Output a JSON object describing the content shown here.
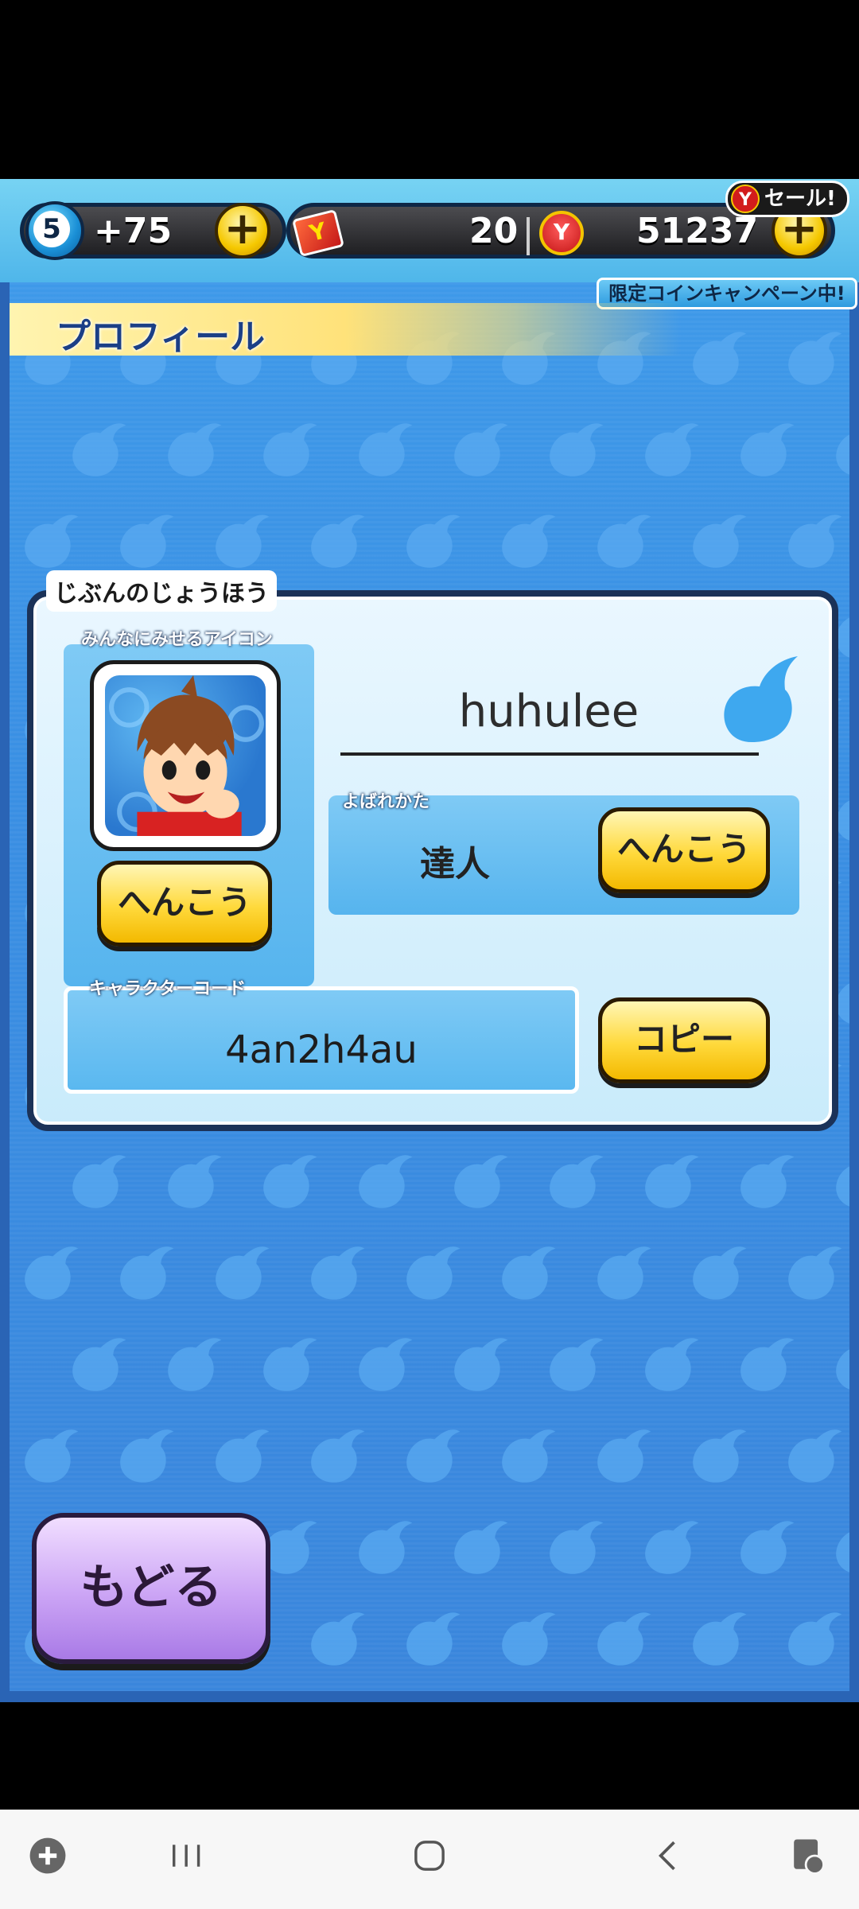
{
  "currency": {
    "level": "5",
    "stamina_gain": "+75",
    "tickets": "20",
    "coins": "51237",
    "ticket_icon_text": "Y",
    "coin_icon_text": "Y"
  },
  "badges": {
    "sale_label": "セール!",
    "sale_icon_text": "Y",
    "campaign_label": "限定コインキャンペーン中!"
  },
  "header": {
    "title": "プロフィール"
  },
  "profile": {
    "section_title": "じぶんのじょうほう",
    "icon_label": "みんなにみせるアイコン",
    "icon_change_button": "へんこう",
    "player_name": "huhulee",
    "alias_label": "よばれかた",
    "alias_value": "達人",
    "alias_change_button": "へんこう",
    "code_label": "キャラクターコード",
    "character_code": "4an2h4au",
    "copy_button": "コピー"
  },
  "back_button": "もどる",
  "plus_symbol": "+",
  "colors": {
    "background_blue": "#3a8fe3",
    "panel_light": "#eaf7ff",
    "button_yellow": "#ffd93b",
    "button_purple": "#cba4f5",
    "header_yellow": "#ffe27a"
  },
  "navbar": {
    "icons": [
      "game-launcher-icon",
      "recent-apps-icon",
      "home-icon",
      "back-icon",
      "screenshot-assist-icon"
    ]
  }
}
